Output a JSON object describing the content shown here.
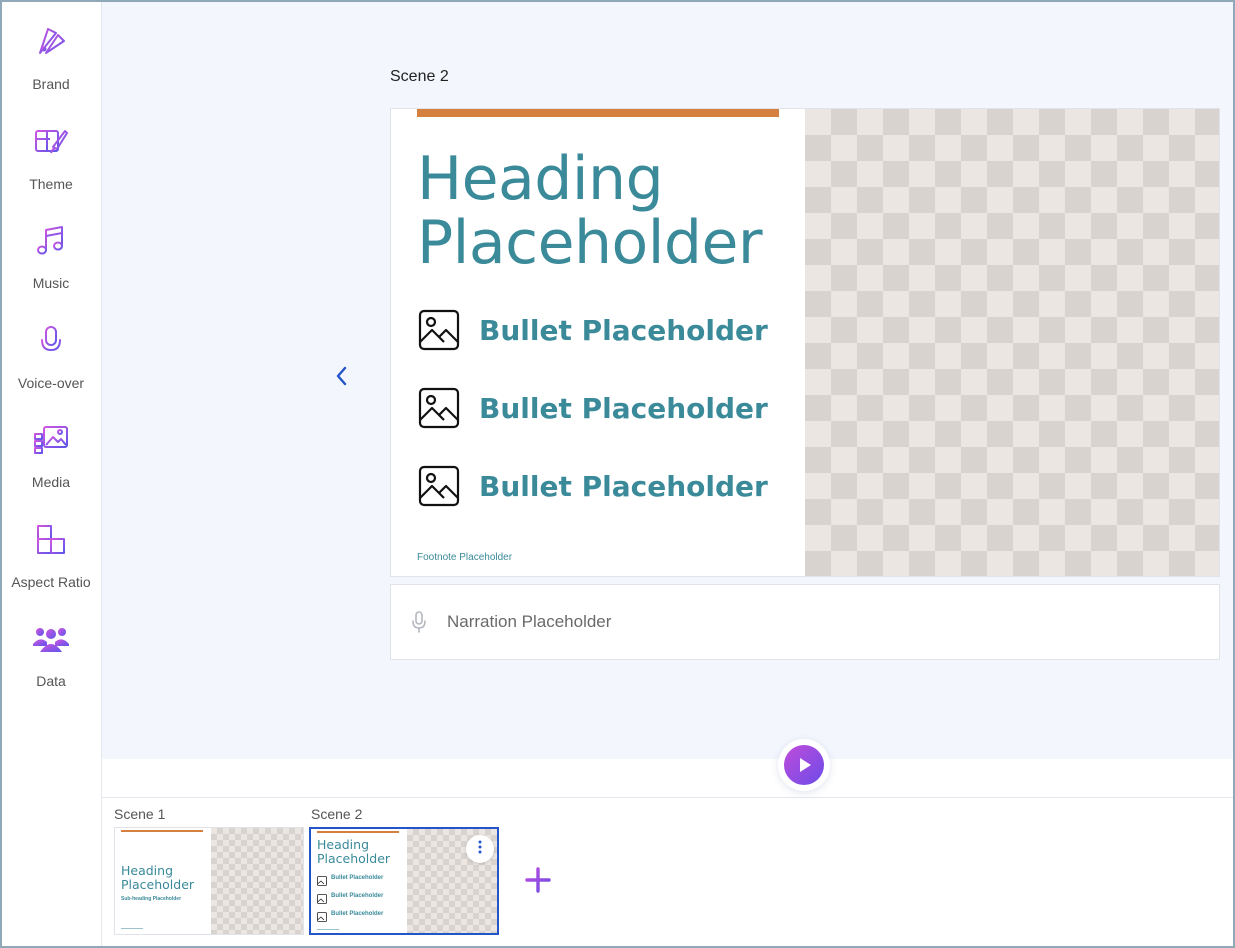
{
  "sidebar": {
    "items": [
      {
        "label": "Brand",
        "icon": "palette-swatch-icon"
      },
      {
        "label": "Theme",
        "icon": "theme-brush-icon"
      },
      {
        "label": "Music",
        "icon": "music-note-icon"
      },
      {
        "label": "Voice-over",
        "icon": "microphone-icon"
      },
      {
        "label": "Media",
        "icon": "media-gallery-icon"
      },
      {
        "label": "Aspect Ratio",
        "icon": "aspect-ratio-icon"
      },
      {
        "label": "Data",
        "icon": "people-data-icon"
      }
    ]
  },
  "editor": {
    "scene_title": "Scene 2",
    "slide": {
      "heading": "Heading Placeholder",
      "bullets": [
        "Bullet Placeholder",
        "Bullet Placeholder",
        "Bullet Placeholder"
      ],
      "footnote": "Footnote Placeholder"
    },
    "narration_placeholder": "Narration Placeholder"
  },
  "timeline": {
    "scenes": [
      {
        "label": "Scene 1",
        "heading": "Heading Placeholder",
        "subheading": "Sub-heading Placeholder"
      },
      {
        "label": "Scene 2",
        "heading": "Heading Placeholder",
        "bullets": [
          "Bullet Placeholder",
          "Bullet Placeholder",
          "Bullet Placeholder"
        ]
      }
    ]
  },
  "colors": {
    "accent_orange": "#d6803f",
    "heading_teal": "#3a8a9a",
    "icon_gradient_start": "#c04bdb",
    "icon_gradient_end": "#6b4de8",
    "selected_border": "#2354c8"
  }
}
